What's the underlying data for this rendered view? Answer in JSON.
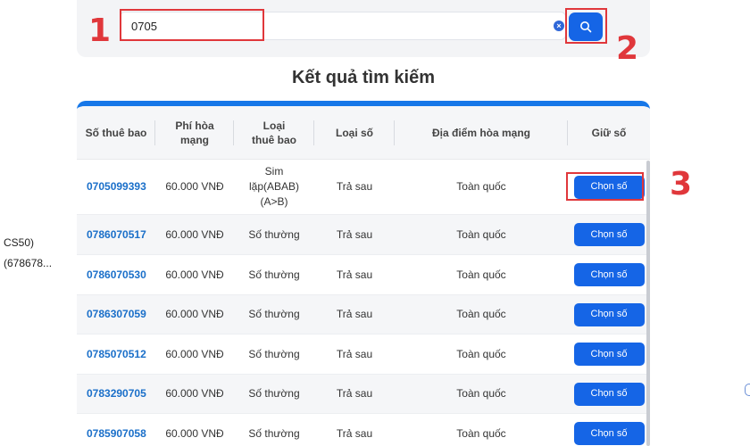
{
  "sidebar_fragments": [
    "CS50)",
    "(678678..."
  ],
  "search": {
    "value": "0705"
  },
  "steps": [
    "1",
    "2",
    "3"
  ],
  "results_title": "Kết quả tìm kiếm",
  "table": {
    "headers": [
      "Số thuê bao",
      "Phí hòa mạng",
      "Loại thuê bao",
      "Loại số",
      "Địa điểm hòa mạng",
      "Giữ số"
    ],
    "rows": [
      {
        "number": "0705099393",
        "fee": "60.000 VNĐ",
        "sub_type": "Sim lặp(ABAB)(A>B)",
        "num_type": "Trả sau",
        "location": "Toàn quốc",
        "action": "Chọn số"
      },
      {
        "number": "0786070517",
        "fee": "60.000 VNĐ",
        "sub_type": "Số thường",
        "num_type": "Trả sau",
        "location": "Toàn quốc",
        "action": "Chọn số"
      },
      {
        "number": "0786070530",
        "fee": "60.000 VNĐ",
        "sub_type": "Số thường",
        "num_type": "Trả sau",
        "location": "Toàn quốc",
        "action": "Chọn số"
      },
      {
        "number": "0786307059",
        "fee": "60.000 VNĐ",
        "sub_type": "Số thường",
        "num_type": "Trả sau",
        "location": "Toàn quốc",
        "action": "Chọn số"
      },
      {
        "number": "0785070512",
        "fee": "60.000 VNĐ",
        "sub_type": "Số thường",
        "num_type": "Trả sau",
        "location": "Toàn quốc",
        "action": "Chọn số"
      },
      {
        "number": "0783290705",
        "fee": "60.000 VNĐ",
        "sub_type": "Số thường",
        "num_type": "Trả sau",
        "location": "Toàn quốc",
        "action": "Chọn số"
      },
      {
        "number": "0785907058",
        "fee": "60.000 VNĐ",
        "sub_type": "Số thường",
        "num_type": "Trả sau",
        "location": "Toàn quốc",
        "action": "Chọn số"
      }
    ]
  },
  "colors": {
    "accent": "#1565e6",
    "highlight": "#e0373b",
    "number_link": "#1a6fc9"
  }
}
